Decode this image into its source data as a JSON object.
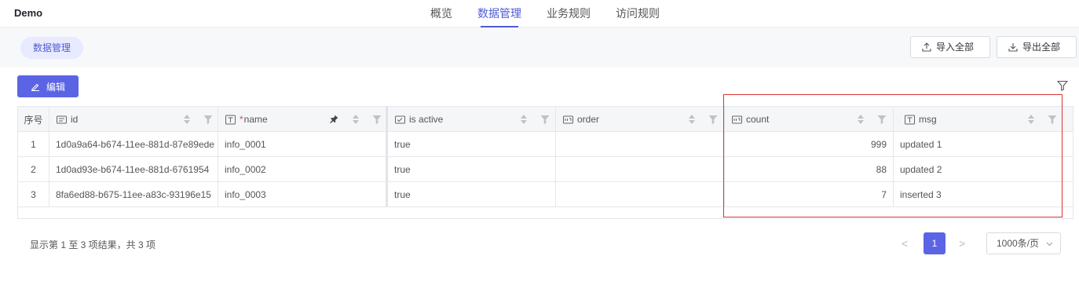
{
  "app": {
    "title": "Demo"
  },
  "nav": {
    "tabs": [
      "概览",
      "数据管理",
      "业务规则",
      "访问规则"
    ],
    "active_index": 1
  },
  "subheader": {
    "pill": "数据管理",
    "import_all": "导入全部",
    "export_all": "导出全部"
  },
  "toolbar": {
    "edit": "编辑"
  },
  "table": {
    "columns": [
      {
        "label": "序号"
      },
      {
        "label": "id",
        "icon": "text-field-icon"
      },
      {
        "label": "name",
        "required": "*",
        "icon": "title-field-icon"
      },
      {
        "label": "is active",
        "icon": "boolean-field-icon"
      },
      {
        "label": "order",
        "icon": "number-field-icon"
      },
      {
        "label": "count",
        "icon": "number-field-icon"
      },
      {
        "label": "msg",
        "icon": "title-field-icon"
      }
    ],
    "rows": [
      {
        "index": "1",
        "id": "1d0a9a64-b674-11ee-881d-87e89ede",
        "name": "info_0001",
        "is_active": "true",
        "order": "",
        "count": "999",
        "msg": "updated 1"
      },
      {
        "index": "2",
        "id": "1d0ad93e-b674-11ee-881d-6761954",
        "name": "info_0002",
        "is_active": "true",
        "order": "",
        "count": "88",
        "msg": "updated 2"
      },
      {
        "index": "3",
        "id": "8fa6ed88-b675-11ee-a83c-93196e15",
        "name": "info_0003",
        "is_active": "true",
        "order": "",
        "count": "7",
        "msg": "inserted 3"
      }
    ]
  },
  "footer": {
    "summary": "显示第 1 至 3 项结果，共 3 项",
    "prev": "<",
    "current_page": "1",
    "next": ">",
    "page_size": "1000条/页"
  },
  "colors": {
    "accent": "#5c64e6",
    "highlight_box": "#dd3333"
  }
}
